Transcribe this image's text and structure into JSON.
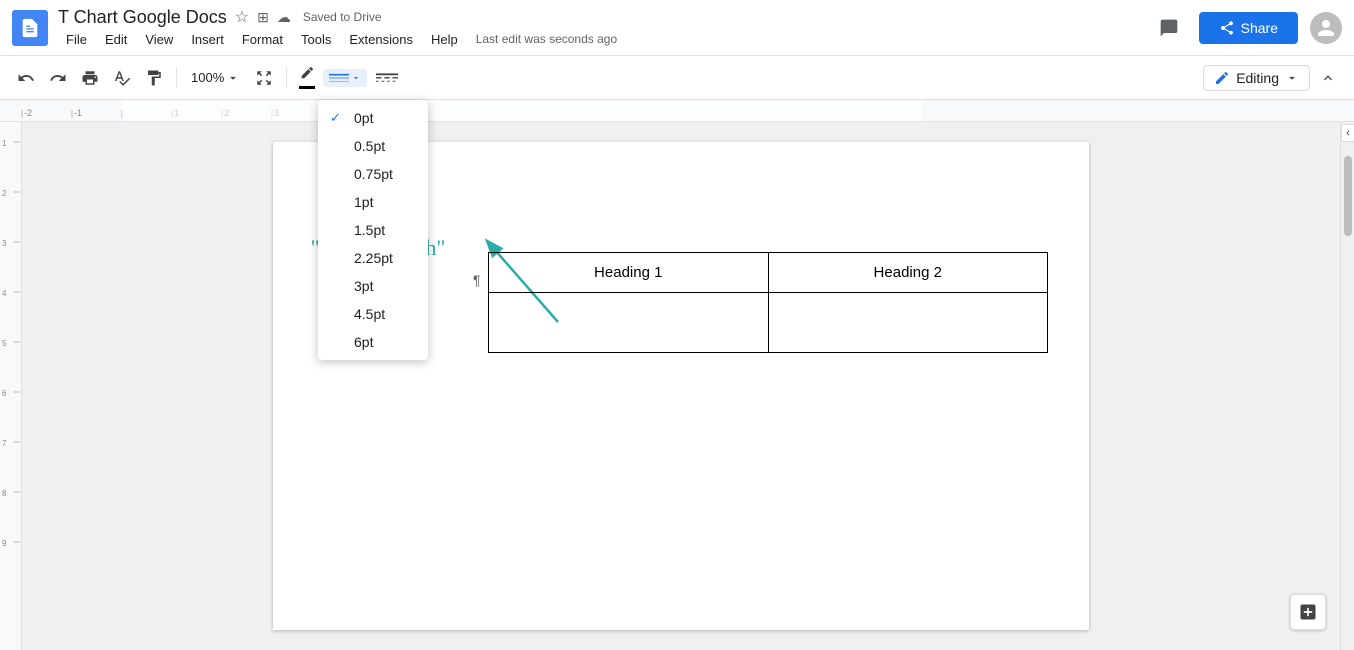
{
  "header": {
    "doc_icon_alt": "Google Docs icon",
    "title": "T Chart Google Docs",
    "saved_status": "Saved to Drive",
    "star_icon": "★",
    "folder_icon": "⊞",
    "cloud_icon": "☁"
  },
  "menu": {
    "items": [
      "File",
      "Edit",
      "View",
      "Insert",
      "Format",
      "Tools",
      "Extensions",
      "Help",
      "Last edit was seconds ago"
    ]
  },
  "toolbar": {
    "undo_label": "↺",
    "redo_label": "↻",
    "print_label": "🖨",
    "spellcheck_label": "✓",
    "paintformat_label": "🖌",
    "zoom": "100%",
    "editing_label": "Editing",
    "border_width_options": [
      "0pt",
      "0.5pt",
      "0.75pt",
      "1pt",
      "1.5pt",
      "2.25pt",
      "3pt",
      "4.5pt",
      "6pt"
    ],
    "selected_border_width": "0pt"
  },
  "document": {
    "annotation": "Go to\n\"Border width\"\nand select\n\"0pt\"",
    "table": {
      "heading1": "Heading 1",
      "heading2": "Heading 2"
    }
  },
  "share_btn": "Share"
}
